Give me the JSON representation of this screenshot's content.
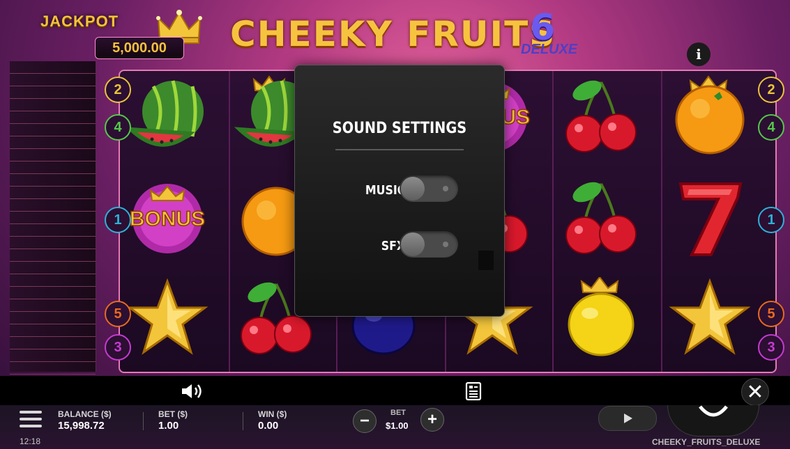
{
  "header": {
    "jackpot_label": "JACKPOT",
    "jackpot_value": "5,000.00",
    "title": "CHEEKY FRUITS",
    "title_number": "6",
    "title_suffix": "DELUXE",
    "info_label": "i"
  },
  "reels": {
    "columns": [
      [
        "watermelon",
        "bonus",
        "star"
      ],
      [
        "watermelon-crowned",
        "orange",
        "cherry"
      ],
      [
        "hidden",
        "hidden",
        "plum"
      ],
      [
        "bonus",
        "cherry",
        "star"
      ],
      [
        "cherry",
        "cherry",
        "lemon-crowned"
      ],
      [
        "orange-crowned",
        "seven",
        "star"
      ]
    ],
    "bonus_text": "BONUS",
    "bonus_partial_text": "US"
  },
  "paylines": {
    "left": [
      "2",
      "4",
      "1",
      "5",
      "3"
    ],
    "right": [
      "2",
      "4",
      "1",
      "5",
      "3"
    ],
    "colors": {
      "2": "#e8c43a",
      "4": "#55c84a",
      "1": "#2db2d8",
      "5": "#e86a1f",
      "3": "#c63bd0"
    }
  },
  "sound_settings": {
    "title": "SOUND SETTINGS",
    "music_label": "MUSIC",
    "music_on": false,
    "sfx_label": "SFX",
    "sfx_on": false
  },
  "menubar": {
    "sound_icon": "speaker-icon",
    "paytable_icon": "paytable-icon",
    "close_icon": "close-icon",
    "close_label": "✕"
  },
  "statusbar": {
    "time": "12:18",
    "balance_label": "BALANCE ($)",
    "balance_value": "15,998.72",
    "bet_label": "BET ($)",
    "bet_value": "1.00",
    "win_label": "WIN ($)",
    "win_value": "0.00",
    "bet_box_label": "BET",
    "bet_box_value": "$1.00",
    "minus_label": "−",
    "plus_label": "+",
    "game_id": "CHEEKY_FRUITS_DELUXE"
  }
}
